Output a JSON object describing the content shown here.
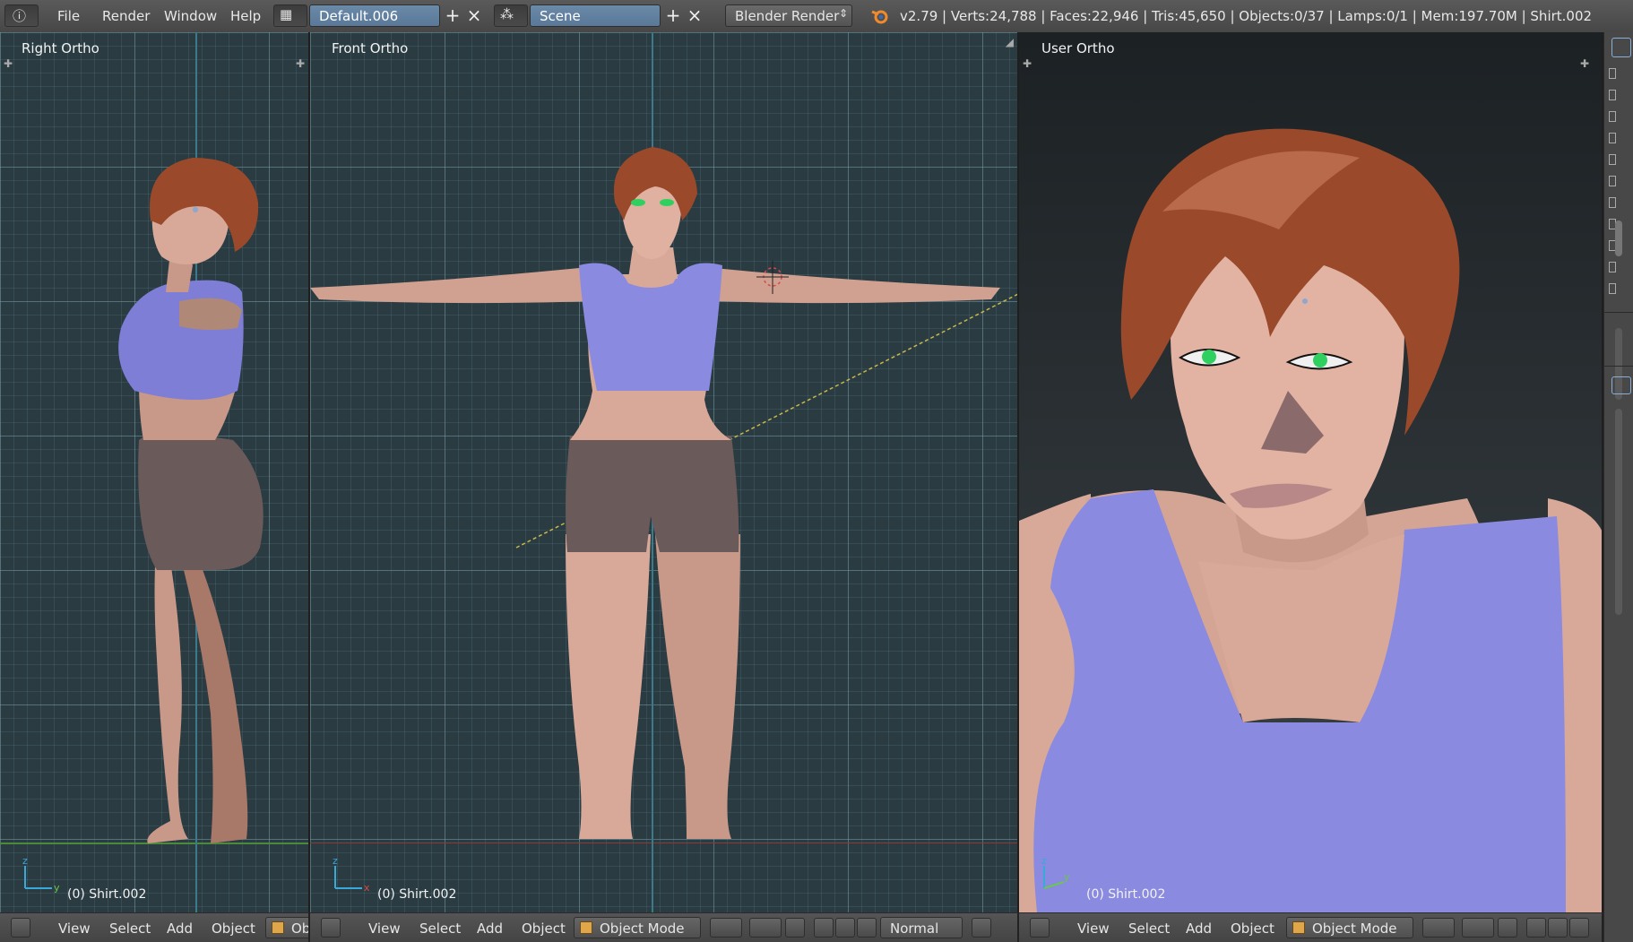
{
  "topbar": {
    "menus": [
      "File",
      "Render",
      "Window",
      "Help"
    ],
    "screen_layout": "Default.006",
    "scene": "Scene",
    "render_engine": "Blender Render",
    "stats": "v2.79 | Verts:24,788 | Faces:22,946 | Tris:45,650 | Objects:0/37 | Lamps:0/1 | Mem:197.70M | Shirt.002",
    "add_symbol": "+",
    "close_symbol": "×"
  },
  "viewports": {
    "left": {
      "label": "Right Ortho",
      "object": "(0) Shirt.002",
      "axis_up": "z",
      "axis_side": "y"
    },
    "middle": {
      "label": "Front Ortho",
      "object": "(0) Shirt.002",
      "axis_up": "z",
      "axis_side": "x"
    },
    "right": {
      "label": "User Ortho",
      "object": "(0) Shirt.002",
      "axis_up": "z",
      "axis_side": "y"
    }
  },
  "bottom_bars": {
    "left": {
      "view": "View",
      "select": "Select",
      "add": "Add",
      "object": "Object",
      "mode_clipped": "Ob"
    },
    "middle": {
      "view": "View",
      "select": "Select",
      "add": "Add",
      "object": "Object",
      "mode": "Object Mode",
      "orientation": "Normal"
    },
    "right": {
      "view": "View",
      "select": "Select",
      "add": "Add",
      "object": "Object",
      "mode": "Object Mode"
    }
  },
  "colors": {
    "header": "#4f4f4f",
    "grid_bg": "#2a3b42",
    "user_ortho_bg": "#2a3033",
    "shirt": "#8a8ae0",
    "skin": "#d8a898",
    "hair": "#9a4a2a",
    "shorts": "#6a5a5a",
    "eyes": "#30d060",
    "mode_cube": "#e0a64a"
  }
}
